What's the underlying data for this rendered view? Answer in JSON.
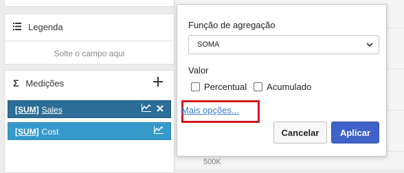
{
  "left_panel": {
    "legend": {
      "icon": "list-icon",
      "title": "Legenda",
      "drop_hint": "Solte o campo aqui"
    },
    "measures": {
      "icon": "sigma-icon",
      "title": "Medições",
      "add_icon": "plus-icon",
      "items": [
        {
          "aggregation": "[SUM]",
          "field": "Sales",
          "selected": true,
          "color": "#2c6e97"
        },
        {
          "aggregation": "[SUM]",
          "field": "Cost",
          "selected": false,
          "color": "#3599cc"
        }
      ]
    }
  },
  "chart_background": {
    "axis_tick": "500K"
  },
  "popup": {
    "aggregation_label": "Função de agregação",
    "aggregation_value": "SOMA",
    "value_label": "Valor",
    "options": [
      {
        "label": "Percentual",
        "checked": false
      },
      {
        "label": "Acumulado",
        "checked": false
      }
    ],
    "more_options": "Mais opções...",
    "highlight_color": "#d2161b",
    "cancel_label": "Cancelar",
    "apply_label": "Aplicar",
    "apply_color": "#3f63c9"
  }
}
